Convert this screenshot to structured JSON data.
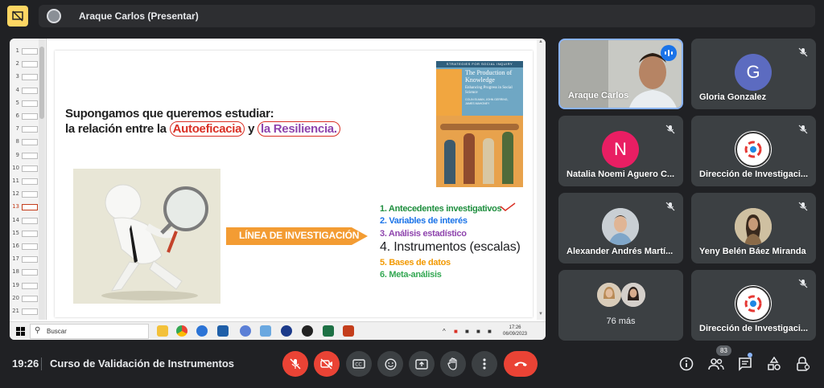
{
  "header": {
    "presenter_title": "Araque Carlos (Presentar)"
  },
  "slide": {
    "question_line1": "Supongamos que queremos estudiar:",
    "question_line2_prefix": "la relación entre la ",
    "word_autoeficacia": "Autoeficacia",
    "word_y": " y ",
    "word_resiliencia": "la Resiliencia.",
    "banner": "LÍNEA DE INVESTIGACIÓN",
    "list": [
      "1. Antecedentes investigativos",
      "2. Variables de interés",
      "3. Análisis estadístico",
      "4. Instrumentos (escalas)",
      "5. Bases de datos",
      "6. Meta-análisis"
    ],
    "book": {
      "series": "STRATEGIES FOR SOCIAL INQUIRY",
      "title": "The Production of Knowledge",
      "subtitle": "Enhancing Progress in Social Science",
      "authors": "COLIN ELMAN, JOHN GERRING, JAMES MAHONEY"
    },
    "thumbnails": [
      "1",
      "2",
      "3",
      "4",
      "5",
      "6",
      "7",
      "8",
      "9",
      "10",
      "11",
      "12",
      "13",
      "14",
      "15",
      "16",
      "17",
      "18",
      "19",
      "20",
      "21"
    ],
    "active_thumbnail": "13"
  },
  "taskbar": {
    "search_placeholder": "Buscar",
    "time": "17:26",
    "date": "06/09/2023"
  },
  "participants": [
    {
      "name": "Araque Carlos",
      "type": "video",
      "speaking": true
    },
    {
      "name": "Gloria Gonzalez",
      "type": "initial",
      "initial": "G",
      "color": "#5c6bc0",
      "muted": true
    },
    {
      "name": "Natalia Noemi Aguero C...",
      "type": "initial",
      "initial": "N",
      "color": "#e91e63",
      "muted": true
    },
    {
      "name": "Dirección de Investigaci...",
      "type": "logo",
      "muted": true
    },
    {
      "name": "Alexander Andrés Martí...",
      "type": "photo",
      "muted": true
    },
    {
      "name": "Yeny Belén Báez Miranda",
      "type": "photo",
      "muted": true
    },
    {
      "name": "76 más",
      "type": "more"
    },
    {
      "name": "Dirección de Investigaci...",
      "type": "logo",
      "muted": true
    }
  ],
  "bottom_bar": {
    "clock": "19:26",
    "meeting_title": "Curso de Validación de Instrumentos",
    "participant_count": "83"
  },
  "colors": {
    "accent_red": "#ea4335",
    "tile_bg": "#3c4043",
    "active_border": "#8ab4f8"
  }
}
